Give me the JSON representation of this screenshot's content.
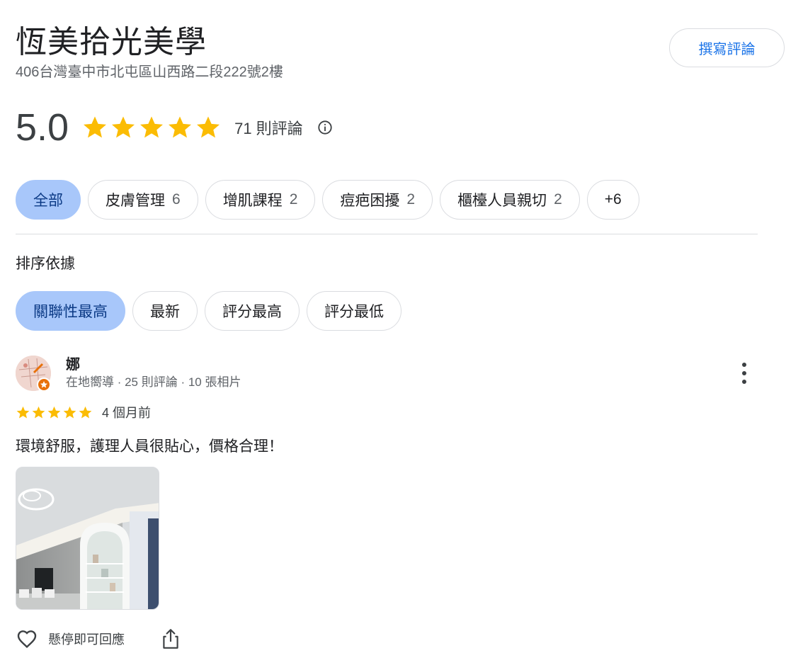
{
  "place": {
    "name": "恆美拾光美學",
    "address": "406台灣臺中市北屯區山西路二段222號2樓"
  },
  "write_review_label": "撰寫評論",
  "rating": {
    "score": "5.0",
    "stars": 5,
    "count_label": "71 則評論",
    "star_color": "#fbbc04"
  },
  "topic_chips": [
    {
      "label": "全部",
      "count": ""
    },
    {
      "label": "皮膚管理",
      "count": "6"
    },
    {
      "label": "增肌課程",
      "count": "2"
    },
    {
      "label": "痘疤困擾",
      "count": "2"
    },
    {
      "label": "櫃檯人員親切",
      "count": "2"
    },
    {
      "label": "+6",
      "count": ""
    }
  ],
  "sort": {
    "label": "排序依據",
    "options": [
      "關聯性最高",
      "最新",
      "評分最高",
      "評分最低"
    ]
  },
  "review": {
    "author": "娜",
    "meta": "在地嚮導 · 25 則評論 · 10 張相片",
    "stars": 5,
    "time": "4 個月前",
    "text": "環境舒服，護理人員很貼心，價格合理！",
    "hover_reply": "懸停即可回應"
  },
  "icons": {
    "info": "info-icon",
    "more": "more-vert-icon",
    "like": "heart-icon",
    "share": "share-icon",
    "badge": "local-guide-star-icon"
  },
  "colors": {
    "accent_blue": "#1a73e8",
    "active_chip_bg": "#a8c7fa",
    "local_guide_orange": "#e8710a"
  }
}
